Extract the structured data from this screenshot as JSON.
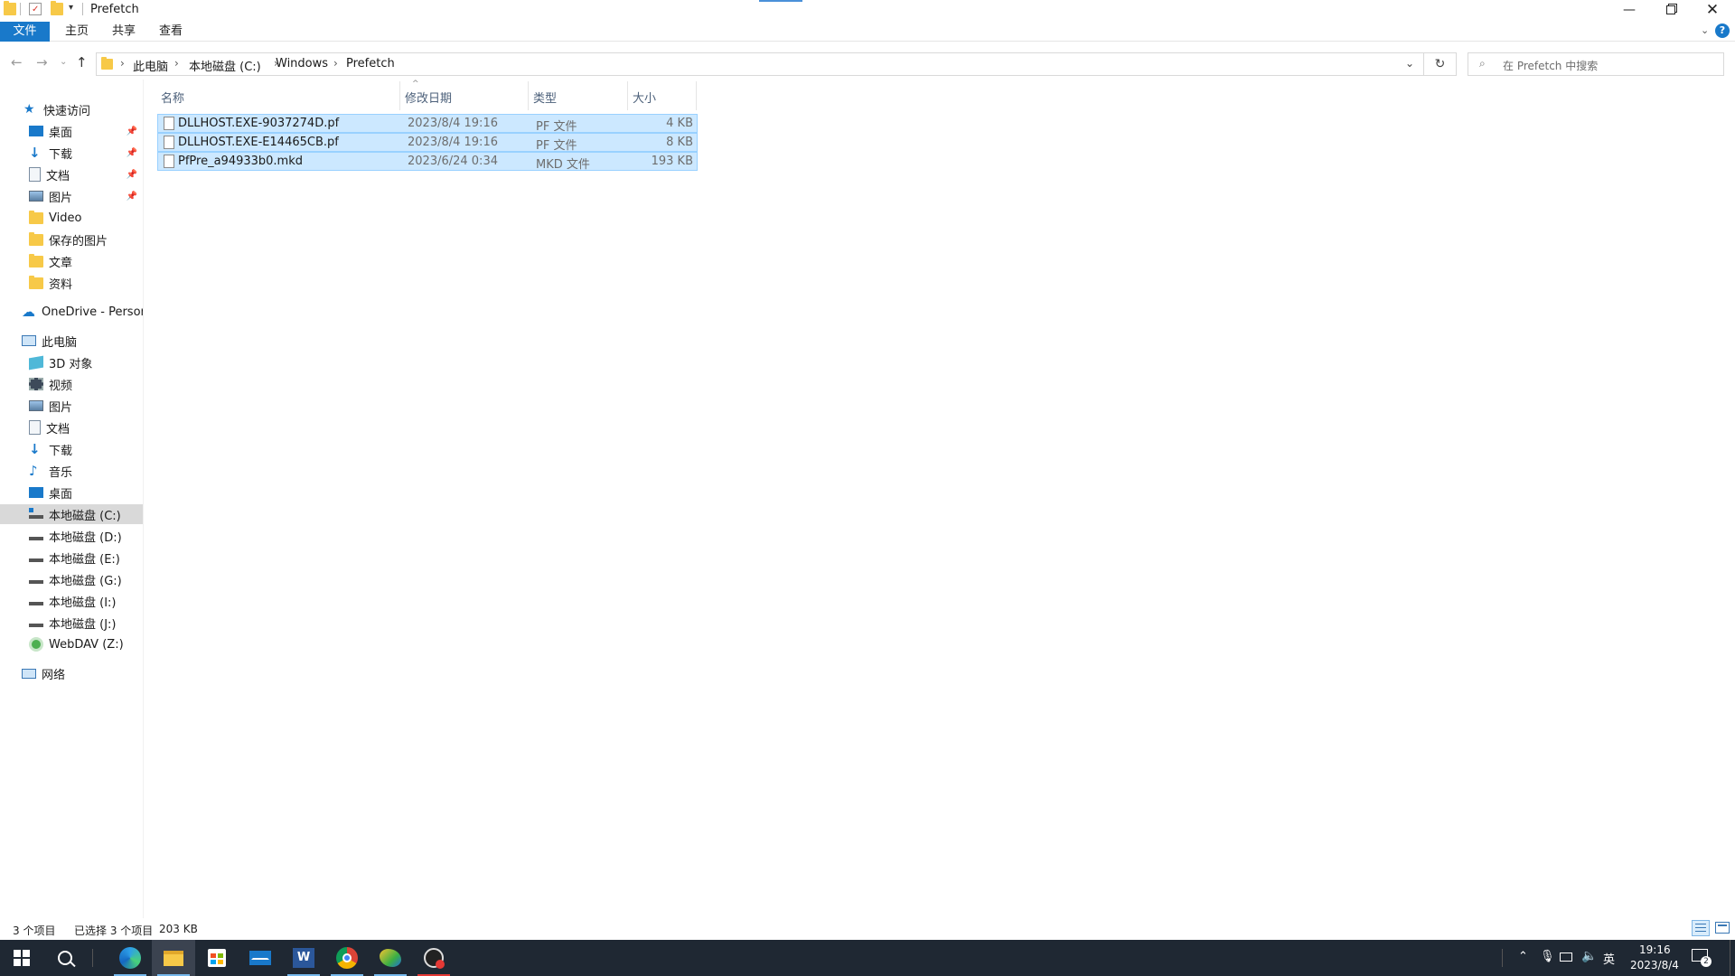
{
  "window": {
    "title": "Prefetch"
  },
  "ribbon": {
    "tabs": [
      "文件",
      "主页",
      "共享",
      "查看"
    ]
  },
  "address": {
    "crumbs": [
      "此电脑",
      "本地磁盘 (C:)",
      "Windows",
      "Prefetch"
    ]
  },
  "search": {
    "placeholder": "在 Prefetch 中搜索"
  },
  "sidebar": {
    "quick_access": "快速访问",
    "quick_items": [
      "桌面",
      "下载",
      "文档",
      "图片",
      "Video",
      "保存的图片",
      "文章",
      "资料"
    ],
    "onedrive": "OneDrive - Persona",
    "this_pc": "此电脑",
    "pc_items": [
      "3D 对象",
      "视频",
      "图片",
      "文档",
      "下载",
      "音乐",
      "桌面"
    ],
    "drives": [
      "本地磁盘 (C:)",
      "本地磁盘 (D:)",
      "本地磁盘 (E:)",
      "本地磁盘 (G:)",
      "本地磁盘 (I:)",
      "本地磁盘 (J:)",
      "WebDAV (Z:)"
    ],
    "network": "网络"
  },
  "columns": {
    "name": "名称",
    "date": "修改日期",
    "type": "类型",
    "size": "大小"
  },
  "files": [
    {
      "name": "DLLHOST.EXE-9037274D.pf",
      "date": "2023/8/4 19:16",
      "type": "PF 文件",
      "size": "4 KB"
    },
    {
      "name": "DLLHOST.EXE-E14465CB.pf",
      "date": "2023/8/4 19:16",
      "type": "PF 文件",
      "size": "8 KB"
    },
    {
      "name": "PfPre_a94933b0.mkd",
      "date": "2023/6/24 0:34",
      "type": "MKD 文件",
      "size": "193 KB"
    }
  ],
  "status": {
    "count": "3 个项目",
    "selected": "已选择 3 个项目",
    "size": "203 KB"
  },
  "taskbar": {
    "time": "19:16",
    "date": "2023/8/4",
    "ime": "英",
    "notifications": "2"
  },
  "colors": {
    "accent": "#1979ca",
    "selection": "#cce8ff",
    "taskbar": "#1f2833"
  }
}
